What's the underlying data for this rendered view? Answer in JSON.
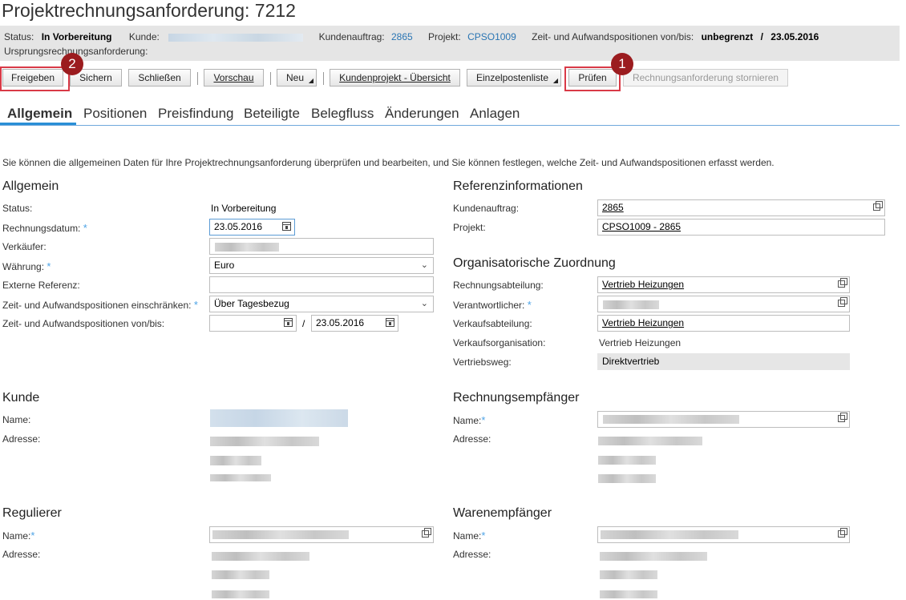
{
  "page": {
    "title": "Projektrechnungsanforderung: 7212",
    "intro": "Sie können die allgemeinen Daten für Ihre Projektrechnungsanforderung überprüfen und bearbeiten, und Sie können festlegen, welche Zeit- und Aufwandspositionen erfasst werden."
  },
  "infobar": {
    "status_label": "Status:",
    "status_value": "In Vorbereitung",
    "kunde_label": "Kunde:",
    "auftrag_label": "Kundenauftrag:",
    "auftrag_value": "2865",
    "projekt_label": "Projekt:",
    "projekt_value": "CPSO1009",
    "zeit_label": "Zeit- und Aufwandspositionen von/bis:",
    "zeit_from": "unbegrenzt",
    "zeit_sep": "/",
    "zeit_to": "23.05.2016",
    "ursprung_label": "Ursprungsrechnungsanforderung:"
  },
  "toolbar": {
    "freigeben": "Freigeben",
    "sichern": "Sichern",
    "schliessen": "Schließen",
    "vorschau": "Vorschau",
    "neu": "Neu",
    "kundenprojekt": "Kundenprojekt - Übersicht",
    "einzelposten": "Einzelpostenliste",
    "pruefen": "Prüfen",
    "stornieren": "Rechnungsanforderung stornieren",
    "separator": "|"
  },
  "badges": {
    "first": "1",
    "second": "2"
  },
  "tabs": [
    "Allgemein",
    "Positionen",
    "Preisfindung",
    "Beteiligte",
    "Belegfluss",
    "Änderungen",
    "Anlagen"
  ],
  "allgemein": {
    "heading": "Allgemein",
    "status_label": "Status:",
    "status_value": "In Vorbereitung",
    "rechnungsdatum_label": "Rechnungsdatum:",
    "rechnungsdatum_value": "23.05.2016",
    "verkaeufer_label": "Verkäufer:",
    "waehrung_label": "Währung:",
    "waehrung_value": "Euro",
    "externe_label": "Externe Referenz:",
    "einschraenken_label": "Zeit- und Aufwandspositionen einschränken:",
    "einschraenken_value": "Über Tagesbezug",
    "vonbis_label": "Zeit- und Aufwandspositionen von/bis:",
    "vonbis_sep": "/",
    "vonbis_to": "23.05.2016",
    "required_mark": "*"
  },
  "referenz": {
    "heading": "Referenzinformationen",
    "auftrag_label": "Kundenauftrag:",
    "auftrag_value": "2865",
    "projekt_label": "Projekt:",
    "projekt_value": "CPSO1009 - 2865"
  },
  "organisation": {
    "heading": "Organisatorische Zuordnung",
    "rechnungsabteilung_label": "Rechnungsabteilung:",
    "rechnungsabteilung_value": "Vertrieb Heizungen",
    "verantwortlicher_label": "Verantwortlicher:",
    "verkaufsabteilung_label": "Verkaufsabteilung:",
    "verkaufsabteilung_value": "Vertrieb Heizungen",
    "verkaufsorg_label": "Verkaufsorganisation:",
    "verkaufsorg_value": "Vertrieb Heizungen",
    "vertriebsweg_label": "Vertriebsweg:",
    "vertriebsweg_value": "Direktvertrieb"
  },
  "kunde": {
    "heading": "Kunde",
    "name_label": "Name:",
    "adresse_label": "Adresse:"
  },
  "rechnungsempfaenger": {
    "heading": "Rechnungsempfänger",
    "name_label": "Name:",
    "adresse_label": "Adresse:"
  },
  "regulierer": {
    "heading": "Regulierer",
    "name_label": "Name:",
    "adresse_label": "Adresse:"
  },
  "warenempfaenger": {
    "heading": "Warenempfänger",
    "name_label": "Name:",
    "adresse_label": "Adresse:"
  },
  "colors": {
    "accent": "#2a75b3",
    "highlight": "#d93a47",
    "badge": "#9b1c1f",
    "required": "#4da3e6"
  }
}
